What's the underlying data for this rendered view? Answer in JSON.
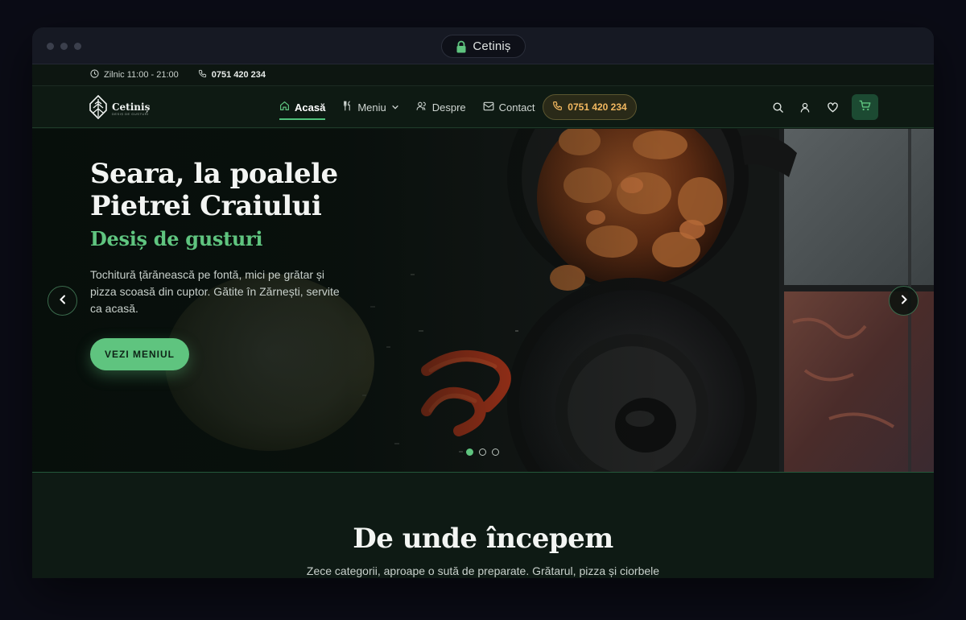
{
  "browser": {
    "tab_title": "Cetiniș"
  },
  "topbar": {
    "hours": "Zilnic 11:00 - 21:00",
    "phone": "0751 420 234"
  },
  "logo": {
    "name": "Cetiniș",
    "tagline": "DESIȘ DE GUSTURI"
  },
  "nav": {
    "items": [
      {
        "label": "Acasă",
        "icon": "home-icon",
        "active": true
      },
      {
        "label": "Meniu",
        "icon": "utensils-icon",
        "dropdown": true
      },
      {
        "label": "Despre",
        "icon": "users-icon"
      },
      {
        "label": "Contact",
        "icon": "mail-icon"
      }
    ],
    "phone_button": "0751 420 234",
    "icons": [
      "search-icon",
      "user-icon",
      "heart-icon",
      "cart-icon"
    ]
  },
  "hero": {
    "title": "Seara, la poalele Pietrei Craiului",
    "subtitle": "Desiș de gusturi",
    "description": "Tochitură țărănească pe fontă, mici pe grătar și pizza scoasă din cuptor. Gătite în Zărnești, servite ca acasă.",
    "cta": "VEZI MENIUL",
    "slides": 3,
    "active_slide": 1
  },
  "section": {
    "title": "De unde începem",
    "description": "Zece categorii, aproape o sută de preparate. Grătarul, pizza și ciorbele"
  },
  "colors": {
    "accent": "#5fc47f",
    "phone_accent": "#f2b860",
    "background": "#0e1a14"
  }
}
